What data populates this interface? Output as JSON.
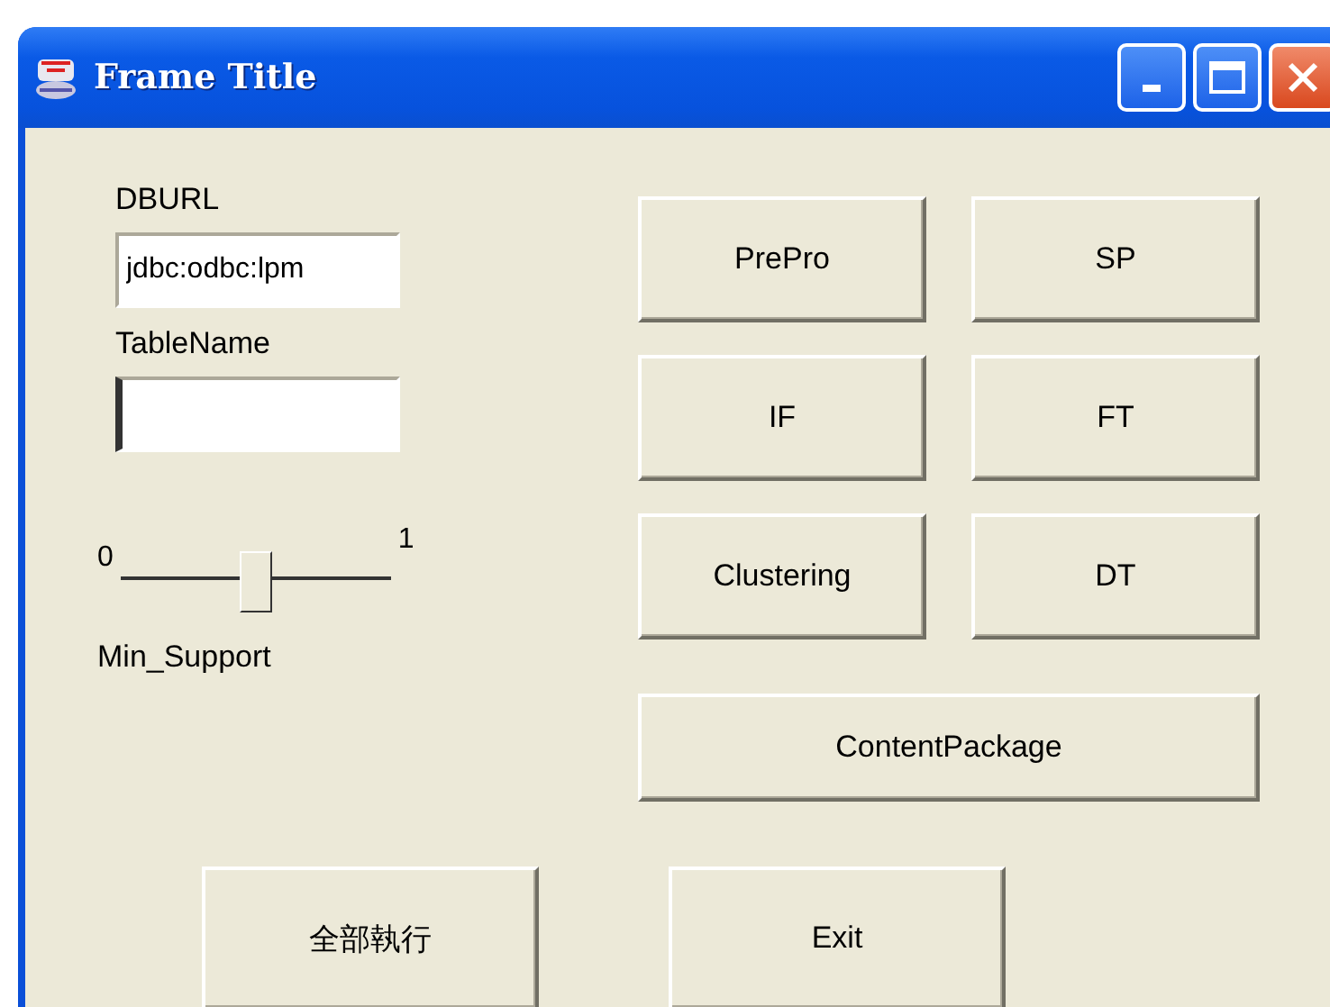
{
  "window": {
    "title": "Frame Title"
  },
  "fields": [
    {
      "label": "DBURL",
      "value": "jdbc:odbc:lpm",
      "focused": false
    },
    {
      "label": "TableName",
      "focused": true
    }
  ],
  "slider": {
    "min": "0",
    "max": "1",
    "label": "Min_Support",
    "level": 0.5
  },
  "buttons": [
    {
      "label": "PrePro"
    },
    {
      "label": "SP"
    },
    {
      "label": "IF"
    },
    {
      "label": "FT"
    },
    {
      "label": "Clustering"
    },
    {
      "label": "DT"
    },
    {
      "label": "ContentPackage",
      "wide": true
    }
  ],
  "bottom_buttons": [
    {
      "label": "全部執行"
    },
    {
      "label": "Exit"
    }
  ]
}
